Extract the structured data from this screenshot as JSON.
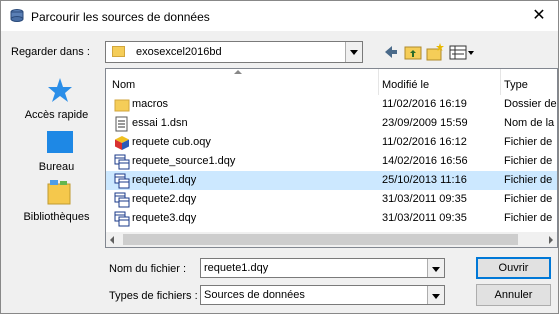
{
  "title": "Parcourir les sources de données",
  "close_glyph": "✕",
  "look_in": {
    "label": "Regarder dans :",
    "value": "exosexcel2016bd"
  },
  "places": [
    {
      "label": "Accès rapide",
      "icon": "star-icon"
    },
    {
      "label": "Bureau",
      "icon": "desktop-icon"
    },
    {
      "label": "Bibliothèques",
      "icon": "libraries-icon"
    }
  ],
  "columns": [
    "Nom",
    "Modifié le",
    "Type"
  ],
  "files": [
    {
      "name": "macros",
      "date": "11/02/2016 16:19",
      "type": "Dossier de",
      "icon": "folder-icon"
    },
    {
      "name": "essai 1.dsn",
      "date": "23/09/2009 15:59",
      "type": "Nom de la",
      "icon": "dsn-file-icon"
    },
    {
      "name": "requete cub.oqy",
      "date": "11/02/2016 16:12",
      "type": "Fichier de",
      "icon": "olap-cube-icon"
    },
    {
      "name": "requete_source1.dqy",
      "date": "14/02/2016 16:56",
      "type": "Fichier de",
      "icon": "query-file-icon"
    },
    {
      "name": "requete1.dqy",
      "date": "25/10/2013 11:16",
      "type": "Fichier de",
      "icon": "query-file-icon",
      "selected": true
    },
    {
      "name": "requete2.dqy",
      "date": "31/03/2011 09:35",
      "type": "Fichier de",
      "icon": "query-file-icon"
    },
    {
      "name": "requete3.dqy",
      "date": "31/03/2011 09:35",
      "type": "Fichier de",
      "icon": "query-file-icon"
    }
  ],
  "file_name": {
    "label": "Nom du fichier :",
    "value": "requete1.dqy"
  },
  "file_type": {
    "label": "Types de fichiers :",
    "value": "Sources de données"
  },
  "buttons": {
    "open": "Ouvrir",
    "cancel": "Annuler"
  },
  "colors": {
    "selection": "#cce8ff",
    "accent": "#0078d7",
    "folder": "#f5cd58"
  }
}
